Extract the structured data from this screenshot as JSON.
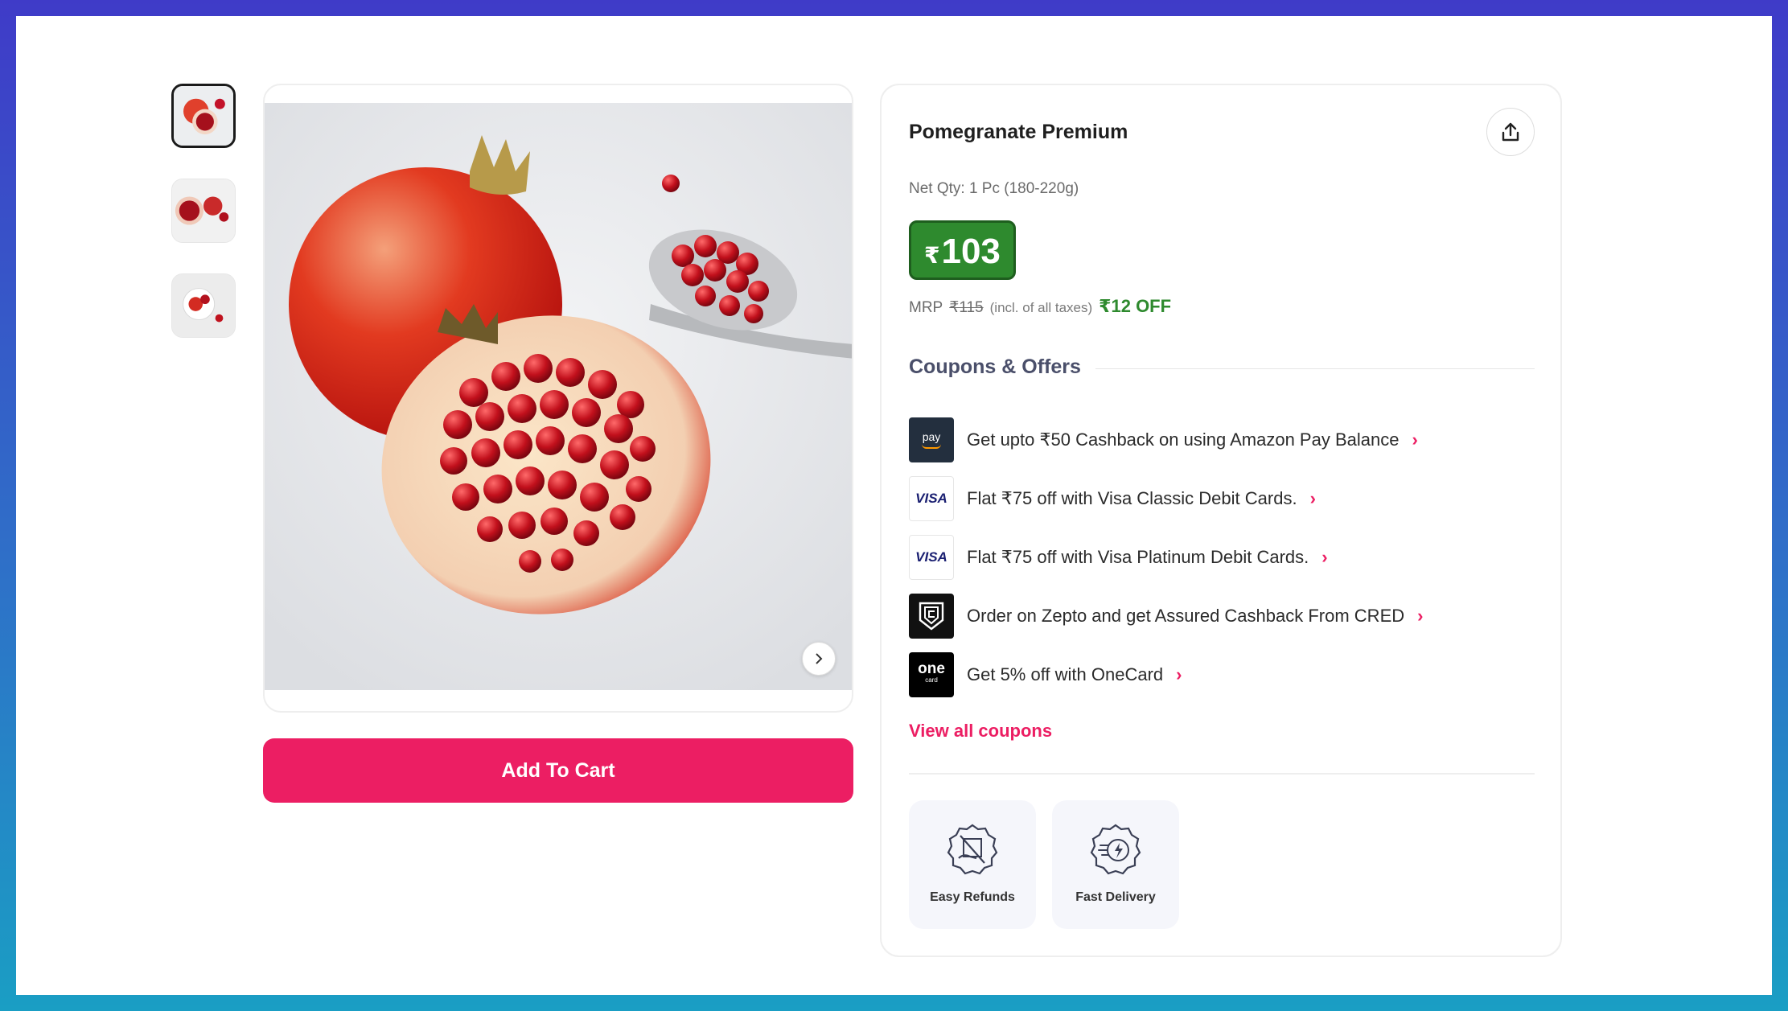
{
  "product": {
    "title": "Pomegranate Premium",
    "net_qty": "Net Qty: 1 Pc (180-220g)",
    "currency_symbol": "₹",
    "price": "103",
    "mrp_label": "MRP",
    "mrp_value": "₹115",
    "tax_note": "(incl. of all taxes)",
    "discount": "₹12 OFF"
  },
  "gallery": {
    "thumbnails": [
      "thumbnail-1",
      "thumbnail-2",
      "thumbnail-3"
    ],
    "active_index": 0
  },
  "actions": {
    "add_to_cart": "Add To Cart"
  },
  "coupons": {
    "section_title": "Coupons & Offers",
    "items": [
      {
        "logo": "pay",
        "text": "Get upto ₹50 Cashback on using Amazon Pay Balance"
      },
      {
        "logo": "VISA",
        "text": "Flat ₹75 off with Visa Classic Debit Cards."
      },
      {
        "logo": "VISA",
        "text": "Flat ₹75 off with Visa Platinum Debit Cards."
      },
      {
        "logo": "cred-logo",
        "text": "Order on Zepto and get Assured Cashback From CRED"
      },
      {
        "logo": "one",
        "logo_sub": "card",
        "text": "Get 5% off with OneCard"
      }
    ],
    "view_all": "View all coupons"
  },
  "features": [
    {
      "icon": "easy-refunds-icon",
      "label": "Easy Refunds"
    },
    {
      "icon": "fast-delivery-icon",
      "label": "Fast Delivery"
    }
  ],
  "colors": {
    "accent": "#ec1e63",
    "price_bg": "#2e8a2e",
    "discount_text": "#2e8a2e"
  }
}
